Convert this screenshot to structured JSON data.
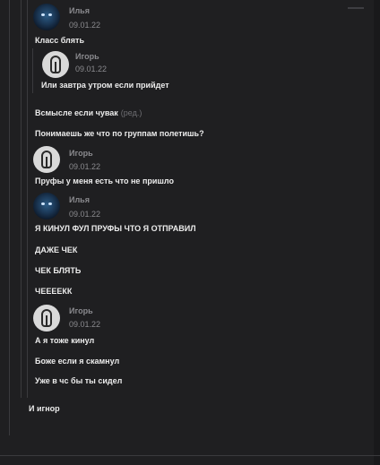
{
  "messages": [
    {
      "author": "Илья",
      "date": "09.01.22",
      "text": "Класс блять"
    },
    {
      "author": "Игорь",
      "date": "09.01.22",
      "text": "Или завтра утром если прийдет"
    },
    {
      "text": "Всмысле если чувак",
      "edited": "(ред.)"
    },
    {
      "text": "Понимаешь же что по группам полетишь?"
    },
    {
      "author": "Игорь",
      "date": "09.01.22",
      "text": "Пруфы у меня есть что не пришло"
    },
    {
      "author": "Илья",
      "date": "09.01.22",
      "text": "Я КИНУЛ ФУЛ ПРУФЫ ЧТО Я ОТПРАВИЛ"
    },
    {
      "text": "ДАЖЕ ЧЕК"
    },
    {
      "text": "ЧЕК БЛЯТЬ"
    },
    {
      "text": "ЧЕЕЕЕКК"
    },
    {
      "author": "Игорь",
      "date": "09.01.22",
      "text": "А я тоже кинул"
    },
    {
      "text": "Боже если я скамнул"
    },
    {
      "text": "Уже в чс бы ты сидел"
    },
    {
      "text": "И игнор"
    }
  ],
  "icons": {
    "avatar_ilya": "avatar-ilya",
    "avatar_igor": "avatar-igor"
  },
  "colors": {
    "background": "#1f1f21",
    "text": "#ececec",
    "meta": "#8a8a8e"
  }
}
